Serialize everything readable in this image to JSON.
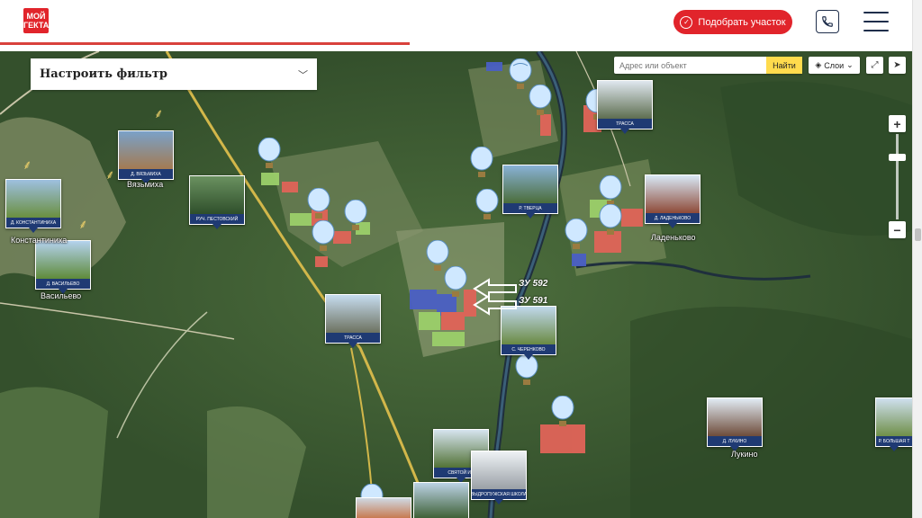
{
  "header": {
    "logo_line1": "МОЙ",
    "logo_line2": "ГЕКТАР",
    "pick_button": "Подобрать участок"
  },
  "filter": {
    "title": "Настроить фильтр"
  },
  "search": {
    "placeholder": "Адрес или объект",
    "find_button": "Найти"
  },
  "layers_button": "Слои",
  "villages": [
    {
      "id": "vyazmikha",
      "label": "Вязьмиха"
    },
    {
      "id": "konstantinikha",
      "label": "Константиниха"
    },
    {
      "id": "vasilevo",
      "label": "Васильево"
    },
    {
      "id": "ladenkovo",
      "label": "Ладеньково"
    },
    {
      "id": "lukino",
      "label": "Лукино"
    }
  ],
  "cards": [
    {
      "id": "c1",
      "caption": "Д. ВЯЗЬМИХА"
    },
    {
      "id": "c2",
      "caption": "Д. КОНСТАНТИНИХА"
    },
    {
      "id": "c3",
      "caption": "Д. ВАСИЛЬЕВО"
    },
    {
      "id": "c4",
      "caption": "РУЧ. ПЕСТОВСКИЙ"
    },
    {
      "id": "c5",
      "caption": "ТРАССА"
    },
    {
      "id": "c6",
      "caption": "Р. ТВЕРЦА"
    },
    {
      "id": "c7",
      "caption": "Д. ЛАДЕНЬКОВО"
    },
    {
      "id": "c8",
      "caption": "ТРАССА"
    },
    {
      "id": "c9",
      "caption": "С. ЧЕРЕНКОВО"
    },
    {
      "id": "c10",
      "caption": "Д. ЛУКИНО"
    },
    {
      "id": "c11",
      "caption": "Р. БОЛЬШАЯ Т"
    },
    {
      "id": "c12",
      "caption": "СВЯТОЙ ИС"
    },
    {
      "id": "c13",
      "caption": "ВЫДРОПУЖСКАЯ ШКОЛА"
    }
  ],
  "plots": [
    {
      "id": "zu592",
      "label": "ЗУ 592"
    },
    {
      "id": "zu591",
      "label": "ЗУ 591"
    }
  ],
  "colors": {
    "brand": "#e1242b",
    "navy": "#1f3a73",
    "find": "#ffdb4d"
  }
}
